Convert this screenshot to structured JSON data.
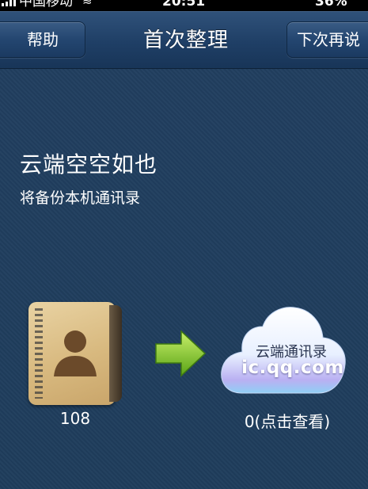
{
  "status_bar": {
    "carrier": "中国移动",
    "time": "20:51",
    "battery": "36%",
    "wifi_icon": "wifi-icon",
    "signal_icon": "signal-icon"
  },
  "nav": {
    "left_button": "帮助",
    "title": "首次整理",
    "right_button": "下次再说"
  },
  "content": {
    "title": "云端空空如也",
    "subtitle": "将备份本机通讯录"
  },
  "local": {
    "icon": "address-book-icon",
    "count": "108"
  },
  "arrow_icon": "right-arrow-icon",
  "cloud": {
    "icon": "cloud-icon",
    "label": "云端通讯录",
    "domain": "ic.qq.com",
    "count": "0(点击查看)"
  }
}
